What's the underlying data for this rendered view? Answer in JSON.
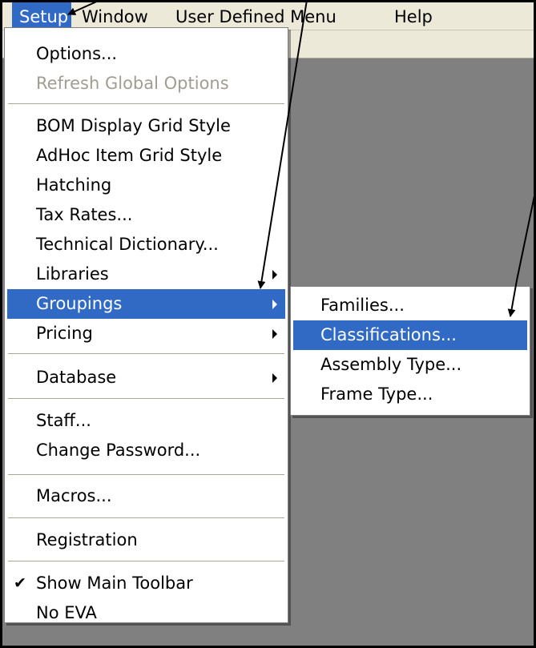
{
  "menubar": {
    "items": [
      "Setup",
      "Window",
      "User Defined Menu",
      "Help"
    ]
  },
  "setup_menu": {
    "options": "Options...",
    "refresh_global_options": "Refresh Global Options",
    "bom_display_grid_style": "BOM Display Grid Style",
    "adhoc_item_grid_style": "AdHoc Item Grid Style",
    "hatching": "Hatching",
    "tax_rates": "Tax Rates...",
    "technical_dictionary": "Technical Dictionary...",
    "libraries": "Libraries",
    "groupings": "Groupings",
    "pricing": "Pricing",
    "database": "Database",
    "staff": "Staff...",
    "change_password": "Change Password...",
    "macros": "Macros...",
    "registration": "Registration",
    "show_main_toolbar": "Show Main Toolbar",
    "show_main_toolbar_checked": true,
    "no_eva": "No EVA"
  },
  "groupings_submenu": {
    "families": "Families...",
    "classifications": "Classifications...",
    "assembly_type": "Assembly Type...",
    "frame_type": "Frame Type..."
  },
  "colors": {
    "highlight": "#316ac5",
    "menubar": "#ece9d8",
    "workspace": "#808080",
    "disabled_text": "#a19d91"
  },
  "icons": {
    "check": "check-mark-icon",
    "submenu": "submenu-arrow-icon"
  }
}
